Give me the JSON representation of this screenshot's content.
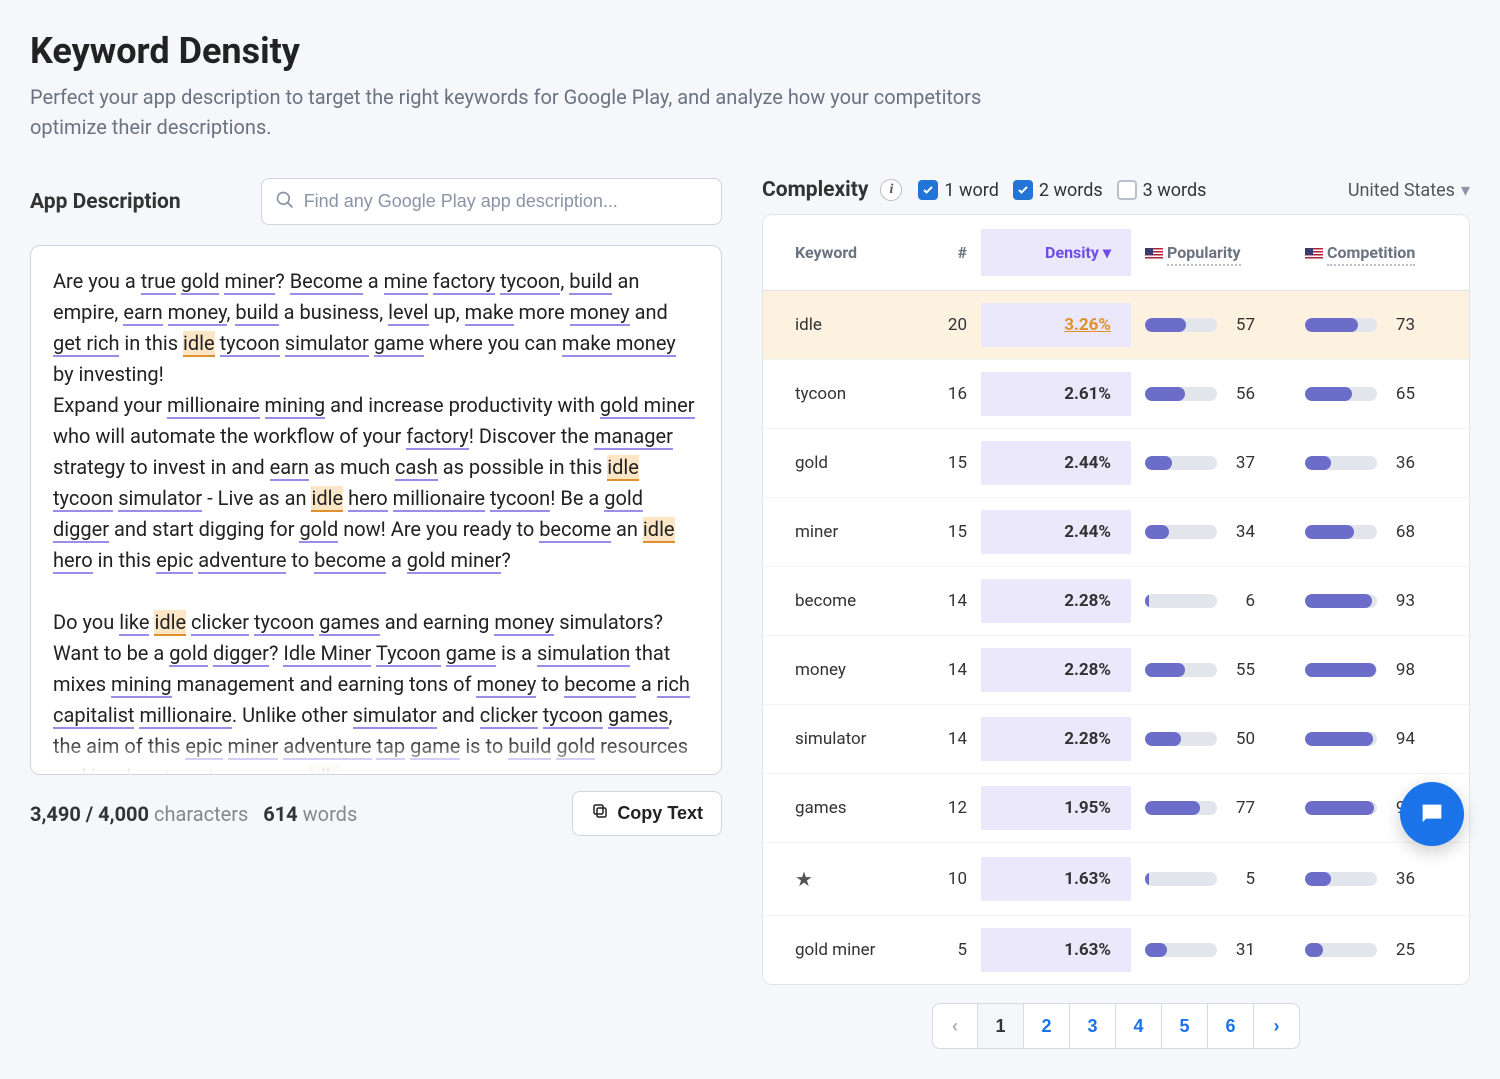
{
  "title": "Keyword Density",
  "subtitle": "Perfect your app description to target the right keywords for Google Play, and analyze how your competitors optimize their descriptions.",
  "leftLabel": "App Description",
  "searchPlaceholder": "Find any Google Play app description...",
  "charCount": "3,490 / 4,000",
  "charLabel": "characters",
  "wordCount": "614",
  "wordLabel": "words",
  "copyLabel": "Copy Text",
  "complexityLabel": "Complexity",
  "checks": {
    "one": "1 word",
    "two": "2 words",
    "three": "3 words"
  },
  "country": "United States",
  "columns": {
    "keyword": "Keyword",
    "count": "#",
    "density": "Density",
    "popularity": "Popularity",
    "competition": "Competition"
  },
  "rows": [
    {
      "keyword": "idle",
      "count": 20,
      "density": "3.26%",
      "pop": 57,
      "comp": 73,
      "hl": true
    },
    {
      "keyword": "tycoon",
      "count": 16,
      "density": "2.61%",
      "pop": 56,
      "comp": 65
    },
    {
      "keyword": "gold",
      "count": 15,
      "density": "2.44%",
      "pop": 37,
      "comp": 36
    },
    {
      "keyword": "miner",
      "count": 15,
      "density": "2.44%",
      "pop": 34,
      "comp": 68
    },
    {
      "keyword": "become",
      "count": 14,
      "density": "2.28%",
      "pop": 6,
      "comp": 93
    },
    {
      "keyword": "money",
      "count": 14,
      "density": "2.28%",
      "pop": 55,
      "comp": 98
    },
    {
      "keyword": "simulator",
      "count": 14,
      "density": "2.28%",
      "pop": 50,
      "comp": 94
    },
    {
      "keyword": "games",
      "count": 12,
      "density": "1.95%",
      "pop": 77,
      "comp": 96
    },
    {
      "keyword": "★",
      "count": 10,
      "density": "1.63%",
      "pop": 5,
      "comp": 36,
      "star": true
    },
    {
      "keyword": "gold miner",
      "count": 5,
      "density": "1.63%",
      "pop": 31,
      "comp": 25
    }
  ],
  "pages": [
    "1",
    "2",
    "3",
    "4",
    "5",
    "6"
  ]
}
